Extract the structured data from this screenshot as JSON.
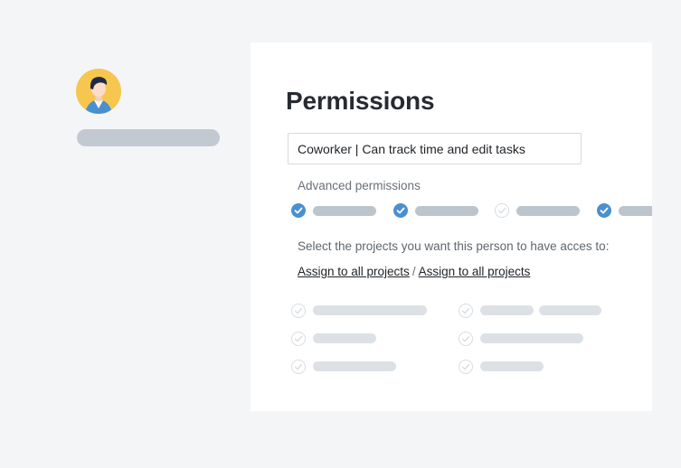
{
  "user": {
    "avatar_icon": "user-avatar-icon"
  },
  "permissions": {
    "title": "Permissions",
    "role_value": "Coworker | Can track time and edit tasks",
    "advanced_label": "Advanced permissions",
    "advanced_items": [
      {
        "checked": true
      },
      {
        "checked": true
      },
      {
        "checked": false
      },
      {
        "checked": true
      }
    ],
    "projects_label": "Select the projects you want this person to have acces to:",
    "assign_link_1": "Assign to all projects",
    "assign_separator": "/",
    "assign_link_2": "Assign to all projects",
    "project_items": [
      {
        "checked": false
      },
      {
        "checked": false
      },
      {
        "checked": false
      },
      {
        "checked": false
      },
      {
        "checked": false
      },
      {
        "checked": false
      }
    ]
  },
  "colors": {
    "accent": "#4a90d0",
    "background": "#f4f5f7",
    "card": "#ffffff",
    "avatar_bg": "#f7c64f"
  }
}
